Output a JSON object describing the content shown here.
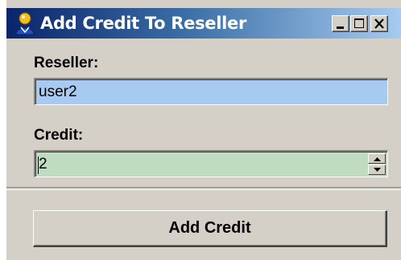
{
  "window": {
    "title": "Add Credit To Reseller",
    "icon": "app-icon",
    "controls": [
      "minimize-icon",
      "maximize-icon",
      "close-icon"
    ]
  },
  "form": {
    "reseller_label": "Reseller:",
    "reseller_value": "user2",
    "credit_label": "Credit:",
    "credit_value": "2"
  },
  "actions": {
    "add_credit_label": "Add Credit"
  },
  "colors": {
    "titlebar_start": "#0a246a",
    "titlebar_end": "#a6caf0",
    "window_bg": "#d4d0c8",
    "reseller_field_bg": "#a6caf0",
    "credit_field_bg": "#c0dcc0"
  }
}
